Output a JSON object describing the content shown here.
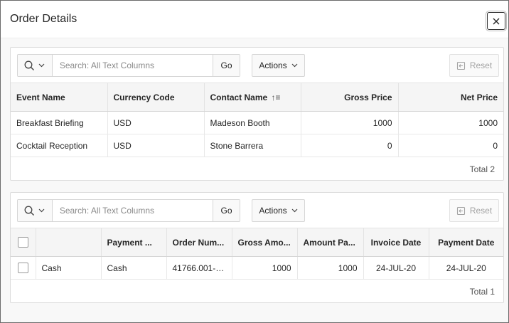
{
  "dialog": {
    "title": "Order Details",
    "close_label": "✕"
  },
  "region1": {
    "search_placeholder": "Search: All Text Columns",
    "go_label": "Go",
    "actions_label": "Actions",
    "reset_label": "Reset",
    "columns": [
      "Event Name",
      "Currency Code",
      "Contact Name",
      "Gross Price",
      "Net Price"
    ],
    "sort_indicator": "↑≡",
    "rows": [
      [
        "Breakfast Briefing",
        "USD",
        "Madeson Booth",
        "1000",
        "1000"
      ],
      [
        "Cocktail Reception",
        "USD",
        "Stone Barrera",
        "0",
        "0"
      ]
    ],
    "total": "Total 2"
  },
  "region2": {
    "search_placeholder": "Search: All Text Columns",
    "go_label": "Go",
    "actions_label": "Actions",
    "reset_label": "Reset",
    "columns": [
      "",
      "",
      "Payment ...",
      "Order Num...",
      "Gross Amo...",
      "Amount Pa...",
      "Invoice Date",
      "Payment Date"
    ],
    "rows": [
      [
        "",
        "Cash",
        "Cash",
        "41766.001-1...",
        "1000",
        "1000",
        "24-JUL-20",
        "24-JUL-20"
      ]
    ],
    "total": "Total 1"
  },
  "icons": {
    "search": "search-icon",
    "chevron": "chevron-down-icon",
    "reset": "reset-icon",
    "close": "close-icon"
  }
}
